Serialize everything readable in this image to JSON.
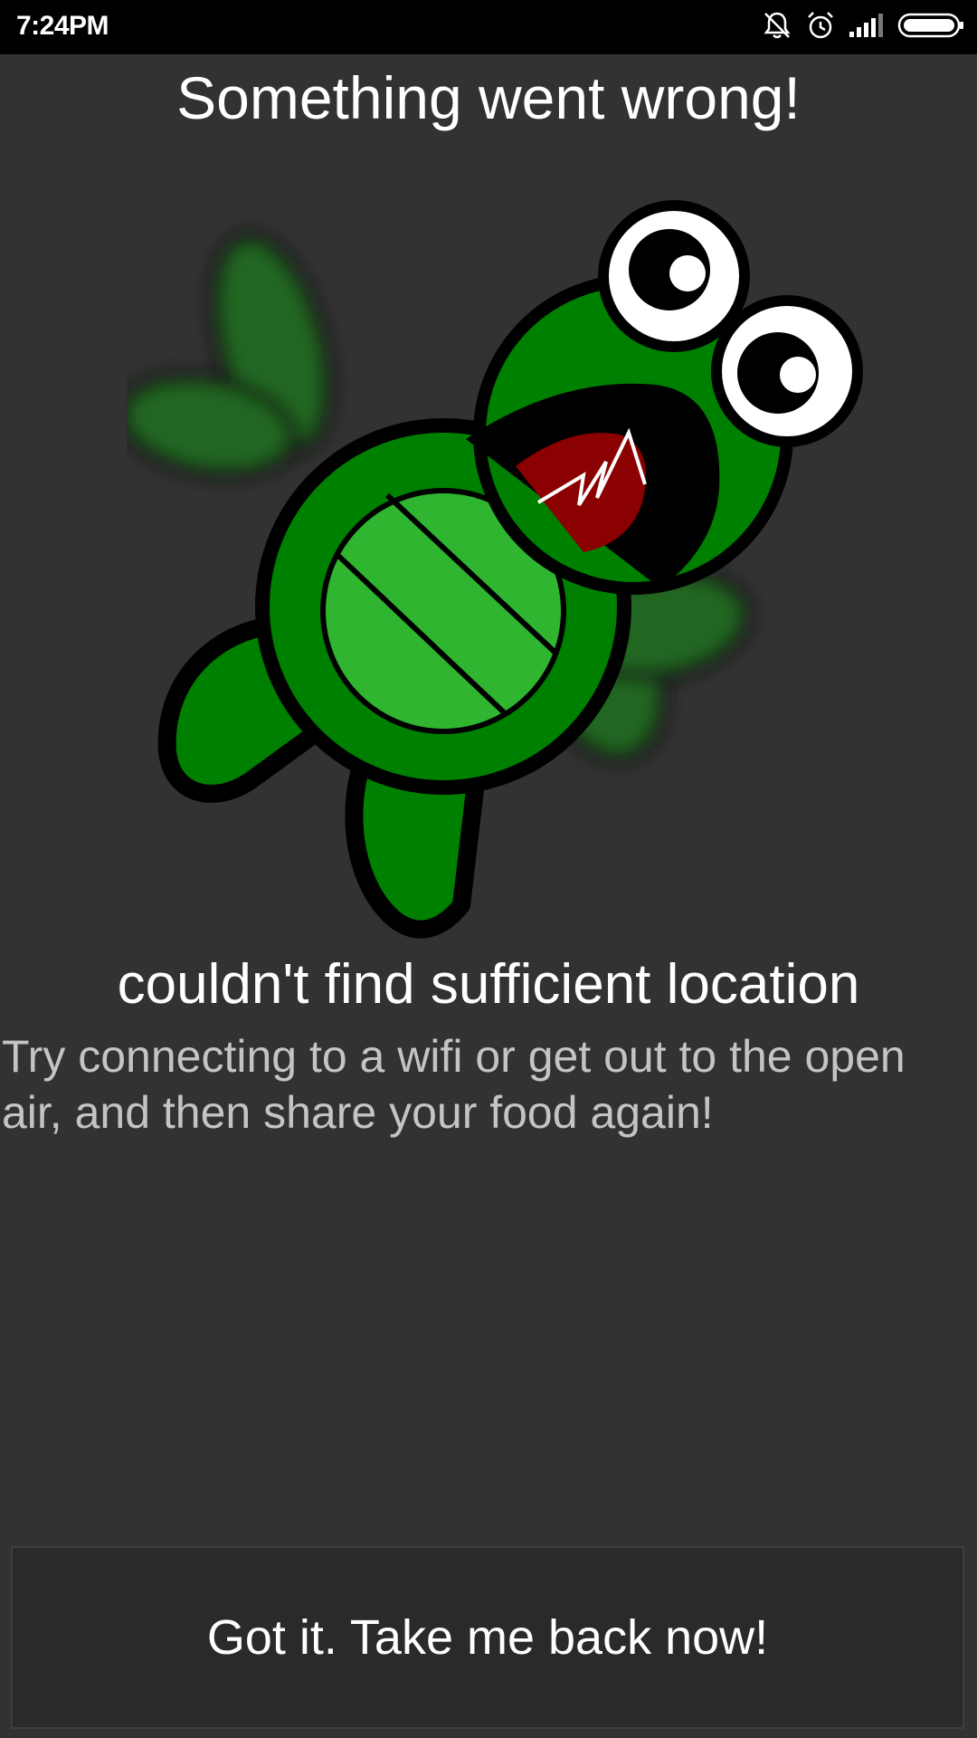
{
  "status_bar": {
    "time": "7:24PM",
    "icons": [
      "bell-off-icon",
      "alarm-icon",
      "signal-icon",
      "battery-icon"
    ]
  },
  "dialog": {
    "title": "Something went wrong!",
    "illustration": "upset-turtle-icon",
    "subtitle": "couldn't find sufficient location",
    "message": "Try connecting to a wifi or get out to the open air, and then share your food again!",
    "button_label": "Got it. Take me back now!"
  },
  "colors": {
    "background": "#323232",
    "status_bar": "#000000",
    "button_bg": "#282a2c",
    "title_text": "#ffffff",
    "message_text": "#c4c4c4",
    "turtle_green": "#008000",
    "turtle_shell": "#2fb52f",
    "mouth_red": "#8b0000"
  }
}
